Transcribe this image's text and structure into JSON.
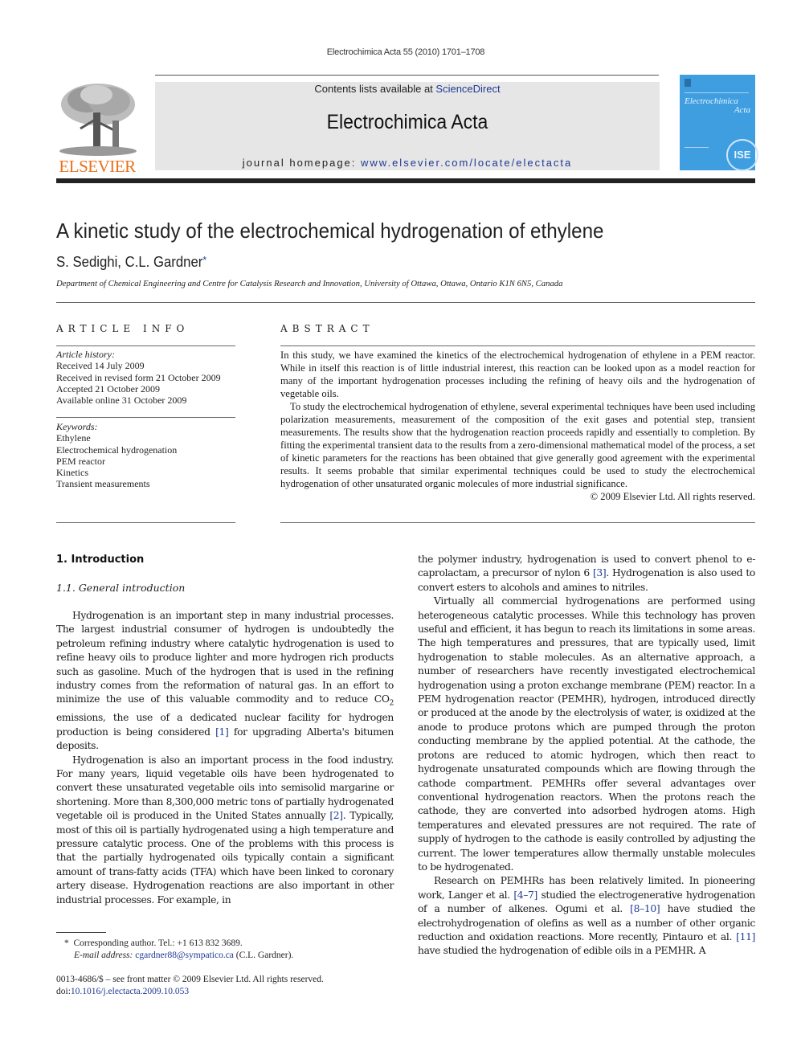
{
  "header": {
    "running_head": "Electrochimica Acta 55 (2010) 1701–1708",
    "contents_prefix": "Contents lists available at ",
    "contents_link": "ScienceDirect",
    "journal_title": "Electrochimica Acta",
    "homepage_prefix": "journal homepage: ",
    "homepage_link": "www.elsevier.com/locate/electacta",
    "publisher": "ELSEVIER",
    "cover_title_1": "Electrochimica",
    "cover_title_2": "Acta",
    "cover_badge": "ISE"
  },
  "article": {
    "title": "A kinetic study of the electrochemical hydrogenation of ethylene",
    "authors": "S. Sedighi, C.L. Gardner",
    "author_mark": "*",
    "affiliation": "Department of Chemical Engineering and Centre for Catalysis Research and Innovation, University of Ottawa, Ottawa, Ontario K1N 6N5, Canada"
  },
  "article_info": {
    "heading": "ARTICLE INFO",
    "history_label": "Article history:",
    "history": [
      "Received 14 July 2009",
      "Received in revised form 21 October 2009",
      "Accepted 21 October 2009",
      "Available online 31 October 2009"
    ],
    "keywords_label": "Keywords:",
    "keywords": [
      "Ethylene",
      "Electrochemical hydrogenation",
      "PEM reactor",
      "Kinetics",
      "Transient measurements"
    ]
  },
  "abstract": {
    "heading": "ABSTRACT",
    "paragraphs": [
      "In this study, we have examined the kinetics of the electrochemical hydrogenation of ethylene in a PEM reactor. While in itself this reaction is of little industrial interest, this reaction can be looked upon as a model reaction for many of the important hydrogenation processes including the refining of heavy oils and the hydrogenation of vegetable oils.",
      "To study the electrochemical hydrogenation of ethylene, several experimental techniques have been used including polarization measurements, measurement of the composition of the exit gases and potential step, transient measurements. The results show that the hydrogenation reaction proceeds rapidly and essentially to completion. By fitting the experimental transient data to the results from a zero-dimensional mathematical model of the process, a set of kinetic parameters for the reactions has been obtained that give generally good agreement with the experimental results. It seems probable that similar experimental techniques could be used to study the electrochemical hydrogenation of other unsaturated organic molecules of more industrial significance."
    ],
    "copyright": "© 2009 Elsevier Ltd. All rights reserved."
  },
  "body": {
    "section_heading": "1.  Introduction",
    "subsection_heading": "1.1.  General introduction",
    "left": {
      "p1_a": "Hydrogenation is an important step in many industrial processes. The largest industrial consumer of hydrogen is undoubtedly the petroleum refining industry where catalytic hydrogenation is used to refine heavy oils to produce lighter and more hydrogen rich products such as gasoline. Much of the hydrogen that is used in the refining industry comes from the reformation of natural gas. In an effort to minimize the use of this valuable commodity and to reduce CO",
      "p1_sub": "2",
      "p1_b": " emissions, the use of a dedicated nuclear facility for hydrogen production is being considered ",
      "p1_ref": "[1]",
      "p1_c": " for upgrading Alberta's bitumen deposits.",
      "p2_a": "Hydrogenation is also an important process in the food industry. For many years, liquid vegetable oils have been hydrogenated to convert these unsaturated vegetable oils into semisolid margarine or shortening. More than 8,300,000 metric tons of partially hydrogenated vegetable oil is produced in the United States annually ",
      "p2_ref": "[2]",
      "p2_b": ". Typically, most of this oil is partially hydrogenated using a high temperature and pressure catalytic process. One of the problems with this process is that the partially hydrogenated oils typically contain a significant amount of trans-fatty acids (TFA) which have been linked to coronary artery disease. Hydrogenation reactions are also important in other industrial processes. For example, in"
    },
    "right": {
      "p1_a": "the polymer industry, hydrogenation is used to convert phenol to e-caprolactam, a precursor of nylon 6 ",
      "p1_ref": "[3]",
      "p1_b": ". Hydrogenation is also used to convert esters to alcohols and amines to nitriles.",
      "p2": "Virtually all commercial hydrogenations are performed using heterogeneous catalytic processes. While this technology has proven useful and efficient, it has begun to reach its limitations in some areas. The high temperatures and pressures, that are typically used, limit hydrogenation to stable molecules. As an alternative approach, a number of researchers have recently investigated electrochemical hydrogenation using a proton exchange membrane (PEM) reactor. In a PEM hydrogenation reactor (PEMHR), hydrogen, introduced directly or produced at the anode by the electrolysis of water, is oxidized at the anode to produce protons which are pumped through the proton conducting membrane by the applied potential. At the cathode, the protons are reduced to atomic hydrogen, which then react to hydrogenate unsaturated compounds which are flowing through the cathode compartment. PEMHRs offer several advantages over conventional hydrogenation reactors. When the protons reach the cathode, they are converted into adsorbed hydrogen atoms. High temperatures and elevated pressures are not required. The rate of supply of hydrogen to the cathode is easily controlled by adjusting the current. The lower temperatures allow thermally unstable molecules to be hydrogenated.",
      "p3_a": "Research on PEMHRs has been relatively limited. In pioneering work, Langer et al. ",
      "p3_ref1": "[4–7]",
      "p3_b": " studied the electrogenerative hydrogenation of a number of alkenes. Ogumi et al. ",
      "p3_ref2": "[8–10]",
      "p3_c": " have studied the electrohydrogenation of olefins as well as a number of other organic reduction and oxidation reactions. More recently, Pintauro et al. ",
      "p3_ref3": "[11]",
      "p3_d": " have studied the hydrogenation of edible oils in a PEMHR. A"
    }
  },
  "footnote": {
    "mark": "*",
    "corresponding": "Corresponding author. Tel.: +1 613 832 3689.",
    "email_label": "E-mail address:",
    "email": "cgardner88@sympatico.ca",
    "email_suffix": " (C.L. Gardner)."
  },
  "front_matter": {
    "issn_line": "0013-4686/$ – see front matter © 2009 Elsevier Ltd. All rights reserved.",
    "doi_prefix": "doi:",
    "doi": "10.1016/j.electacta.2009.10.053"
  }
}
